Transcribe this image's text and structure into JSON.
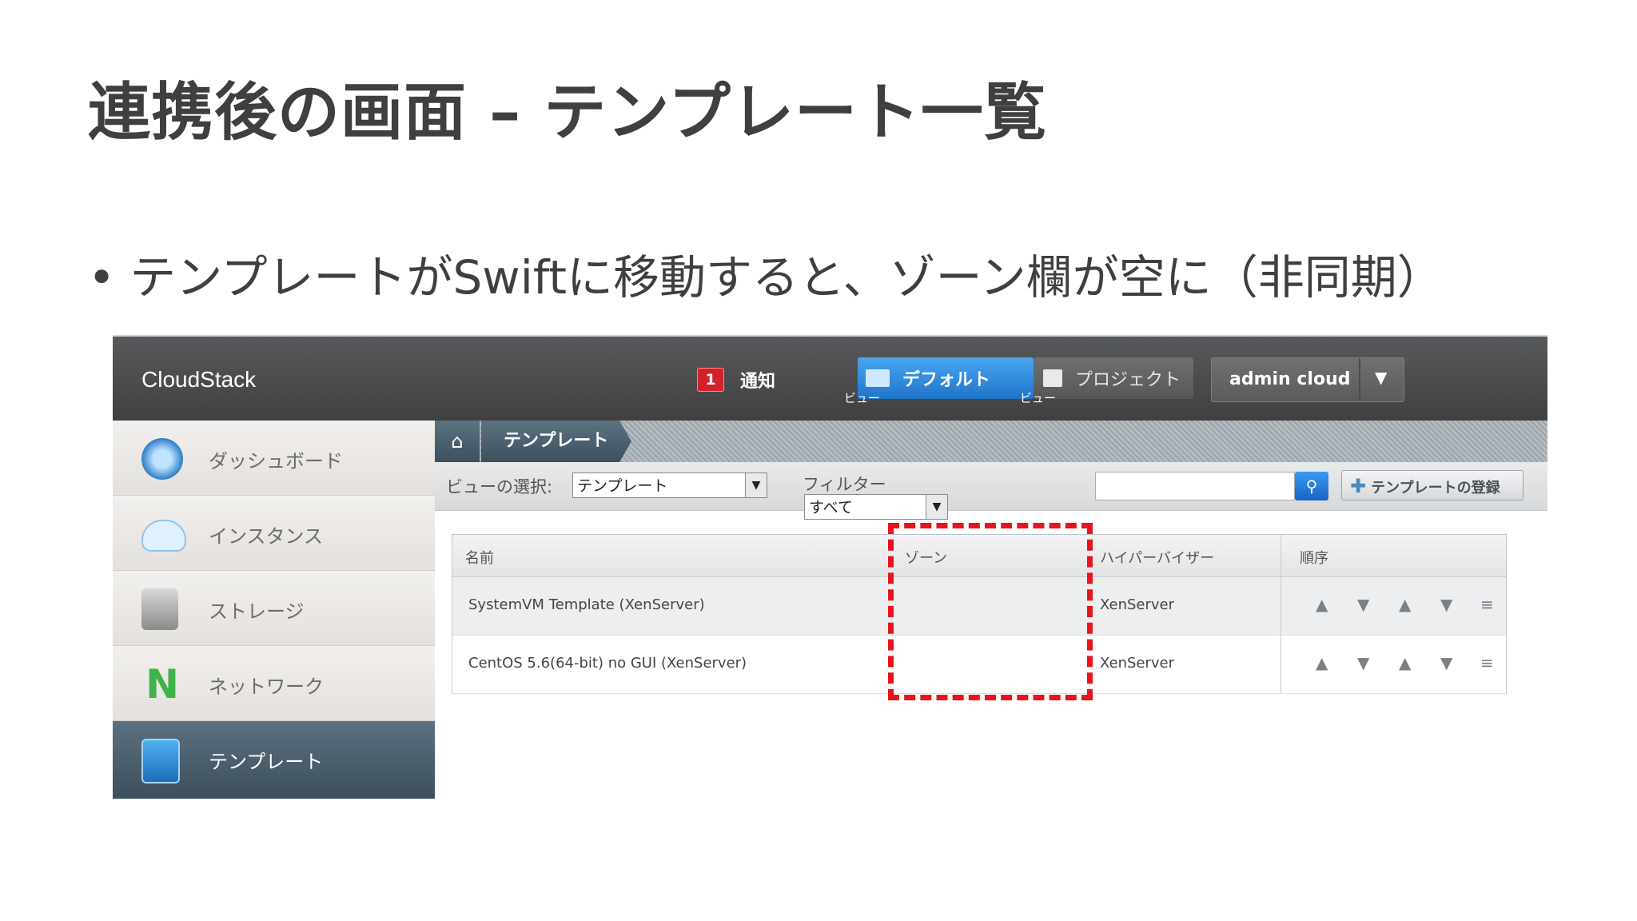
{
  "slide": {
    "title": "連携後の画面 – テンプレート一覧",
    "bullet_marker": "•",
    "bullet": "テンプレートがSwiftに移動すると、ゾーン欄が空に（非同期）"
  },
  "app": {
    "logo": "CloudStack",
    "notifications": {
      "count": "1",
      "label": "通知"
    },
    "views": [
      {
        "label": "デフォルト",
        "sub": "ビュー",
        "icon": "folder-icon",
        "active": true
      },
      {
        "label": "プロジェクト",
        "sub": "ビュー",
        "icon": "box-icon",
        "active": false
      }
    ],
    "user": {
      "name": "admin cloud",
      "menu_icon": "chevron-down-icon"
    }
  },
  "sidebar": {
    "items": [
      {
        "label": "ダッシュボード",
        "icon": "dashboard-gauge-icon"
      },
      {
        "label": "インスタンス",
        "icon": "cloud-icon"
      },
      {
        "label": "ストレージ",
        "icon": "hard-disk-icon"
      },
      {
        "label": "ネットワーク",
        "icon": "network-icon"
      },
      {
        "label": "テンプレート",
        "icon": "template-icon",
        "active": true
      }
    ]
  },
  "breadcrumb": {
    "home_icon": "home-icon",
    "current": "テンプレート"
  },
  "toolbar": {
    "view_select_label": "ビューの選択:",
    "view_select_value": "テンプレート",
    "filter_label": "フィルター",
    "filter_value": "すべて",
    "search_placeholder": "",
    "add_button": "テンプレートの登録"
  },
  "table": {
    "columns": [
      "名前",
      "ゾーン",
      "ハイパーバイザー",
      "順序"
    ],
    "rows": [
      {
        "name": "SystemVM Template (XenServer)",
        "zone": "",
        "hypervisor": "XenServer"
      },
      {
        "name": "CentOS 5.6(64-bit) no GUI (XenServer)",
        "zone": "",
        "hypervisor": "XenServer"
      }
    ],
    "order_actions": [
      "▲",
      "▼",
      "▲",
      "▼",
      "≡"
    ]
  },
  "colors": {
    "highlight": "#e8141c",
    "topbar": "#4a4b4d",
    "active_view": "#2a86dc"
  }
}
